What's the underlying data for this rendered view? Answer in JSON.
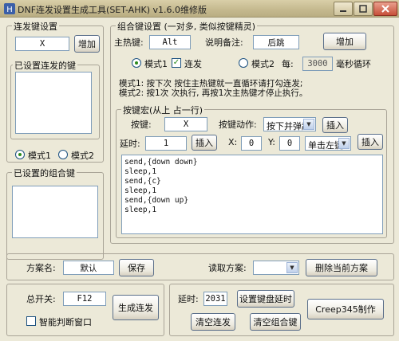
{
  "window": {
    "title": "DNF连发设置生成工具(SET-AHK) v1.6.0维修版",
    "icon": "app-icon",
    "controls": [
      "minimize",
      "maximize",
      "close"
    ]
  },
  "burst_settings": {
    "legend": "连发键设置",
    "key_value": "X",
    "add_label": "增加",
    "set_keys_legend": "已设置连发的键",
    "mode1_label": "模式1",
    "mode2_label": "模式2",
    "selected_mode": "mode1"
  },
  "combo_set_legend": "已设置的组合键",
  "combo_settings": {
    "legend": "组合键设置 (一对多, 类似按键精灵)",
    "hotkey_label": "主热键:",
    "hotkey_value": "Alt",
    "note_label": "说明备注:",
    "note_value": "后跳",
    "add_label": "增加",
    "mode1_label": "模式1",
    "burst_label": "连发",
    "burst_checked": true,
    "mode2_label": "模式2",
    "every_label": "每:",
    "interval_value": "3000",
    "interval_unit": "毫秒循环",
    "desc_line1": "模式1: 按下次                          按住主热键就一直循环请打勾连发;",
    "desc_line2": "模式2: 按1次                           次执行, 再按1次主热键才停止执行。",
    "selected_mode": "mode1"
  },
  "macro": {
    "legend": "按键宏(从上                                             占一行)",
    "key_label": "按键:",
    "key_value": "X",
    "action_label": "按键动作:",
    "action_value": "按下并弹起",
    "insert_label": "插入",
    "delay_label": "延时:",
    "delay_value": "1",
    "x_label": "X:",
    "x_value": "0",
    "y_label": "Y:",
    "y_value": "0",
    "mouse_value": "单击左键",
    "script_lines": [
      "send,{down down}",
      "sleep,1",
      "send,{c}",
      "sleep,1",
      "send,{down up}",
      "sleep,1"
    ]
  },
  "scheme": {
    "name_label": "方案名:",
    "name_value": "默认",
    "save_label": "保存",
    "load_label": "读取方案:",
    "load_value": "",
    "delete_label": "删除当前方案"
  },
  "master": {
    "switch_label": "总开关:",
    "switch_value": "F12",
    "generate_label": "生成连发",
    "smart_window_label": "智能判断窗口",
    "smart_window_checked": false
  },
  "delay_panel": {
    "delay_label": "延时:",
    "delay_value": "2031",
    "set_delay_label": "设置键盘延时",
    "clear_burst_label": "清空连发",
    "clear_combo_label": "清空组合键",
    "credit_label": "Creep345制作"
  }
}
